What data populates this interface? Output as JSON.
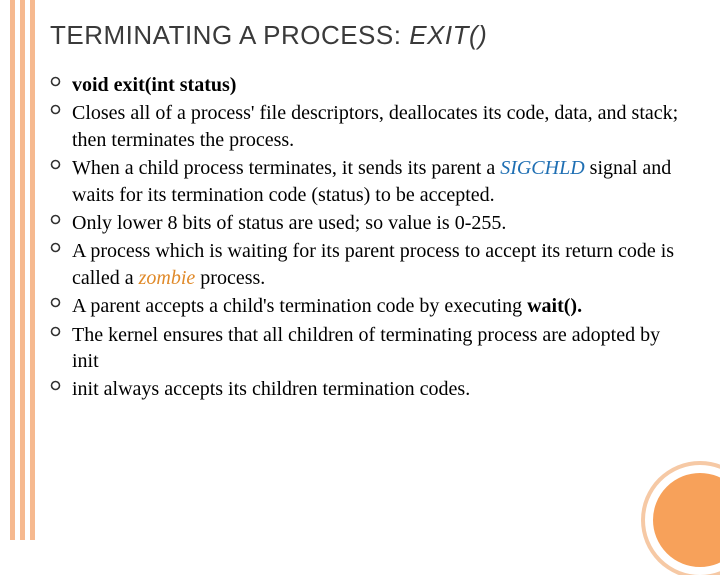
{
  "title": {
    "main": "TERMINATING A PROCESS: ",
    "ital": "EXIT()"
  },
  "bullets": {
    "b0": {
      "bold": "void exit(int status)"
    },
    "b1": {
      "pre": "Closes all of a process' file descriptors, deallocates its code, data, and stack; then terminates the process."
    },
    "b2": {
      "pre": "When a child process terminates, it sends its parent a ",
      "blue": "SIGCHLD",
      "post": " signal and waits for its termination code (status) to be accepted."
    },
    "b3": {
      "pre": "Only lower 8 bits of status are used; so value is 0-255."
    },
    "b4": {
      "pre": "A process which is waiting for its parent process to accept its return code is called a ",
      "orange": "zombie",
      "post": " process."
    },
    "b5": {
      "pre": "A parent accepts a child's termination code by executing ",
      "bold": "wait().",
      "post": ""
    },
    "b6": {
      "pre": "The kernel ensures that all children of terminating process are adopted by init"
    },
    "b7": {
      "pre": "init always accepts its children termination codes."
    }
  }
}
